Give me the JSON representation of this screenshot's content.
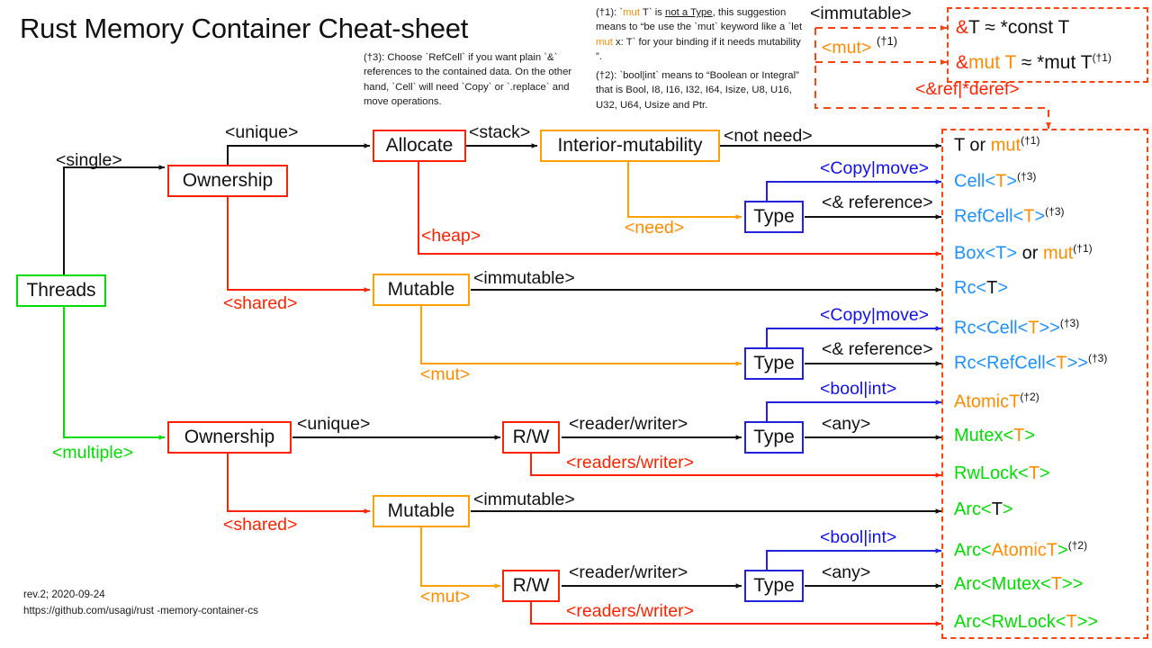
{
  "title": "Rust Memory Container Cheat-sheet",
  "footer": {
    "rev": "rev.2; 2020-09-24",
    "url": "https://github.com/usagi/rust -memory-container-cs"
  },
  "notes": {
    "n3_prefix": "(†3): Choose `RefCell` if you want plain `&` references to the contained data. On the other hand, `Cell` will need `Copy` or `.replace` and move operations.",
    "n1_a": "(†1): `",
    "n1_mut1": "mut",
    "n1_b": " T` is ",
    "n1_u": "not a Type",
    "n1_c": ", this suggestion means to “be use the `mut` keyword like a `let ",
    "n1_mut2": "mut",
    "n1_d": " x: T` for your binding if it needs mutability ”.",
    "n2": "(†2): `bool|int` means to “Boolean or Integral” that is Bool, I8, I16, I32, I64, Isize, U8, U16, U32, U64,  Usize and Ptr."
  },
  "nodes": {
    "threads": "Threads",
    "ownership_single": "Ownership",
    "allocate": "Allocate",
    "interior_mutability": "Interior-mutability",
    "type_s1": "Type",
    "mutable_single": "Mutable",
    "type_s2": "Type",
    "ownership_multi": "Ownership",
    "rw_m1": "R/W",
    "type_m1": "Type",
    "mutable_multi": "Mutable",
    "rw_m2": "R/W",
    "type_m2": "Type"
  },
  "edge_labels": {
    "single": "<single>",
    "multiple": "<multiple>",
    "unique_s": "<unique>",
    "shared_s": "<shared>",
    "stack": "<stack>",
    "heap": "<heap>",
    "not_need": "<not need>",
    "need": "<need>",
    "copy_move_1": "<Copy|move>",
    "ref_1": "<& reference>",
    "immutable_s": "<immutable>",
    "mut_s": "<mut>",
    "copy_move_2": "<Copy|move>",
    "ref_2": "<& reference>",
    "unique_m": "<unique>",
    "shared_m": "<shared>",
    "reader_writer_1": "<reader/writer>",
    "readers_writer_1": "<readers/writer>",
    "boolint_1": "<bool|int>",
    "any_1": "<any>",
    "immutable_m": "<immutable>",
    "mut_m": "<mut>",
    "reader_writer_2": "<reader/writer>",
    "readers_writer_2": "<readers/writer>",
    "boolint_2": "<bool|int>",
    "any_2": "<any>",
    "immutable_ref": "<immutable>",
    "mut_ref": "<mut>",
    "mut_ref_sup": "(†1)",
    "refderef": "<&ref|*deref>"
  },
  "ref_box": {
    "line1_amp": "&",
    "line1_rest": "T ≈ *const T",
    "line2_amp": "&",
    "line2_mut": "mut",
    "line2_T": " T",
    "line2_rest": " ≈ *mut T",
    "line2_sup": "(†1)"
  },
  "results": [
    {
      "id": "t-or-mut",
      "parts": [
        {
          "t": "T or ",
          "c": "black"
        },
        {
          "t": "mut",
          "c": "orange"
        }
      ],
      "sup": "(†1)"
    },
    {
      "id": "cell",
      "parts": [
        {
          "t": "Cell<",
          "c": "blue"
        },
        {
          "t": "T",
          "c": "orange"
        },
        {
          "t": ">",
          "c": "blue"
        }
      ],
      "sup": "(†3)"
    },
    {
      "id": "refcell",
      "parts": [
        {
          "t": "RefCell<",
          "c": "blue"
        },
        {
          "t": "T",
          "c": "orange"
        },
        {
          "t": ">",
          "c": "blue"
        }
      ],
      "sup": "(†3)"
    },
    {
      "id": "box-or-mut",
      "parts": [
        {
          "t": "Box<T>",
          "c": "blue"
        },
        {
          "t": " or ",
          "c": "black"
        },
        {
          "t": "mut",
          "c": "orange"
        }
      ],
      "sup": "(†1)"
    },
    {
      "id": "rc",
      "parts": [
        {
          "t": "Rc<",
          "c": "blue"
        },
        {
          "t": "T",
          "c": "black"
        },
        {
          "t": ">",
          "c": "blue"
        }
      ],
      "sup": ""
    },
    {
      "id": "rc-cell",
      "parts": [
        {
          "t": "Rc<Cell<",
          "c": "blue"
        },
        {
          "t": "T",
          "c": "orange"
        },
        {
          "t": ">>",
          "c": "blue"
        }
      ],
      "sup": "(†3)"
    },
    {
      "id": "rc-refcell",
      "parts": [
        {
          "t": "Rc<RefCell<",
          "c": "blue"
        },
        {
          "t": "T",
          "c": "orange"
        },
        {
          "t": ">>",
          "c": "blue"
        }
      ],
      "sup": "(†3)"
    },
    {
      "id": "atomict",
      "parts": [
        {
          "t": "AtomicT",
          "c": "orange"
        }
      ],
      "sup": "(†2)"
    },
    {
      "id": "mutex",
      "parts": [
        {
          "t": "Mutex<",
          "c": "green"
        },
        {
          "t": "T",
          "c": "orange"
        },
        {
          "t": ">",
          "c": "green"
        }
      ],
      "sup": ""
    },
    {
      "id": "rwlock",
      "parts": [
        {
          "t": "RwLock<",
          "c": "green"
        },
        {
          "t": "T",
          "c": "orange"
        },
        {
          "t": ">",
          "c": "green"
        }
      ],
      "sup": ""
    },
    {
      "id": "arc",
      "parts": [
        {
          "t": "Arc<",
          "c": "green"
        },
        {
          "t": "T",
          "c": "black"
        },
        {
          "t": ">",
          "c": "green"
        }
      ],
      "sup": ""
    },
    {
      "id": "arc-atomict",
      "parts": [
        {
          "t": "Arc<",
          "c": "green"
        },
        {
          "t": "AtomicT",
          "c": "orange"
        },
        {
          "t": ">",
          "c": "green"
        }
      ],
      "sup": "(†2)"
    },
    {
      "id": "arc-mutex",
      "parts": [
        {
          "t": "Arc<Mutex<",
          "c": "green"
        },
        {
          "t": "T",
          "c": "orange"
        },
        {
          "t": ">>",
          "c": "green"
        }
      ],
      "sup": ""
    },
    {
      "id": "arc-rwlock",
      "parts": [
        {
          "t": "Arc<RwLock<",
          "c": "green"
        },
        {
          "t": "T",
          "c": "orange"
        },
        {
          "t": ">>",
          "c": "green"
        }
      ],
      "sup": ""
    }
  ],
  "colors": {
    "red": "#FF2200",
    "orange": "#FFA000",
    "orange_text": "#FF8C00",
    "blue": "#2222DD",
    "blue_text": "#1E90FF",
    "green": "#00DD00",
    "black": "#111111",
    "dash_red": "#FF4411"
  }
}
